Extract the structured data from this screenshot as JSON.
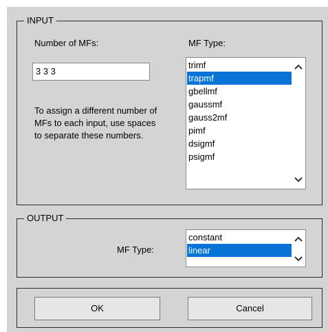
{
  "input": {
    "title": "INPUT",
    "num_mfs_label": "Number of MFs:",
    "num_mfs_value": "3 3 3",
    "help_text": "To assign a different number of MFs to each input, use spaces to separate these numbers.",
    "mf_type_label": "MF Type:",
    "mf_types": [
      "trimf",
      "trapmf",
      "gbellmf",
      "gaussmf",
      "gauss2mf",
      "pimf",
      "dsigmf",
      "psigmf"
    ],
    "selected_mf_type": "trapmf"
  },
  "output": {
    "title": "OUTPUT",
    "mf_type_label": "MF Type:",
    "mf_types": [
      "constant",
      "linear"
    ],
    "selected_mf_type": "linear"
  },
  "buttons": {
    "ok_label": "OK",
    "cancel_label": "Cancel"
  },
  "icons": {
    "scroll_up": "chevron-up-icon",
    "scroll_down": "chevron-down-icon"
  },
  "colors": {
    "selection": "#0a74d6",
    "dialog_bg": "#d4d4d4"
  }
}
